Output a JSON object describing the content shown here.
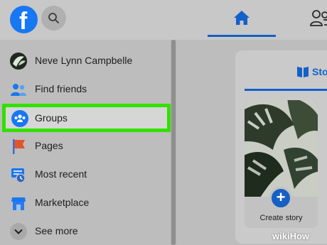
{
  "topbar": {
    "logo_icon": "facebook-logo",
    "search_icon": "search-icon",
    "home_icon": "home-icon",
    "friends_icon": "friends-icon",
    "accent": "#1460c9"
  },
  "sidebar": {
    "items": [
      {
        "label": "Neve Lynn Campbelle",
        "icon": "avatar"
      },
      {
        "label": "Find friends",
        "icon": "friends-icon"
      },
      {
        "label": "Groups",
        "icon": "groups-icon",
        "highlighted": true
      },
      {
        "label": "Pages",
        "icon": "flag-icon"
      },
      {
        "label": "Most recent",
        "icon": "clock-feed-icon"
      },
      {
        "label": "Marketplace",
        "icon": "store-icon"
      },
      {
        "label": "See more",
        "icon": "chevron-down-icon"
      }
    ],
    "highlight_color": "#33e000"
  },
  "stories": {
    "tab_label": "Sto",
    "tab_icon": "book-icon",
    "create_label": "Create story",
    "create_icon": "plus-icon"
  },
  "watermark": {
    "wiki": "wiki",
    "how": "How"
  }
}
